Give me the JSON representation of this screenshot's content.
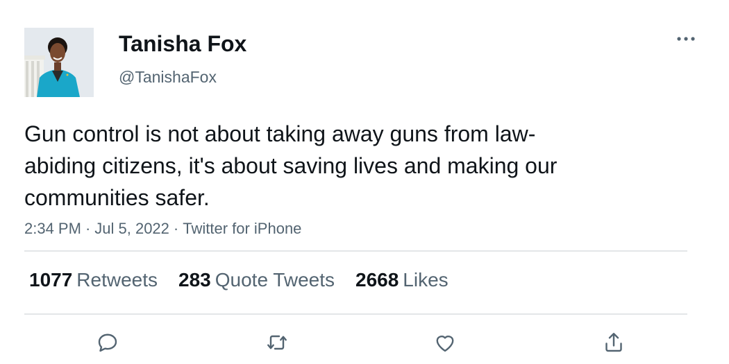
{
  "user": {
    "display_name": "Tanisha Fox",
    "handle": "@TanishaFox",
    "avatar": "profile-photo"
  },
  "tweet": {
    "text": "Gun control is not about taking away guns from law-abiding citizens, it's about saving lives and making our communities safer.",
    "time": "2:34 PM",
    "date": "Jul 5, 2022",
    "source": "Twitter for iPhone",
    "separator": "·"
  },
  "stats": {
    "retweets": {
      "count": "1077",
      "label": "Retweets"
    },
    "quote_tweets": {
      "count": "283",
      "label": "Quote Tweets"
    },
    "likes": {
      "count": "2668",
      "label": "Likes"
    }
  },
  "actions": [
    {
      "icon": "reply-icon"
    },
    {
      "icon": "retweet-icon"
    },
    {
      "icon": "like-icon"
    },
    {
      "icon": "share-icon"
    }
  ],
  "colors": {
    "text_primary": "#0f1419",
    "text_secondary": "#536471",
    "divider": "#e3e6e8",
    "avatar_jacket": "#1aa7c9"
  }
}
